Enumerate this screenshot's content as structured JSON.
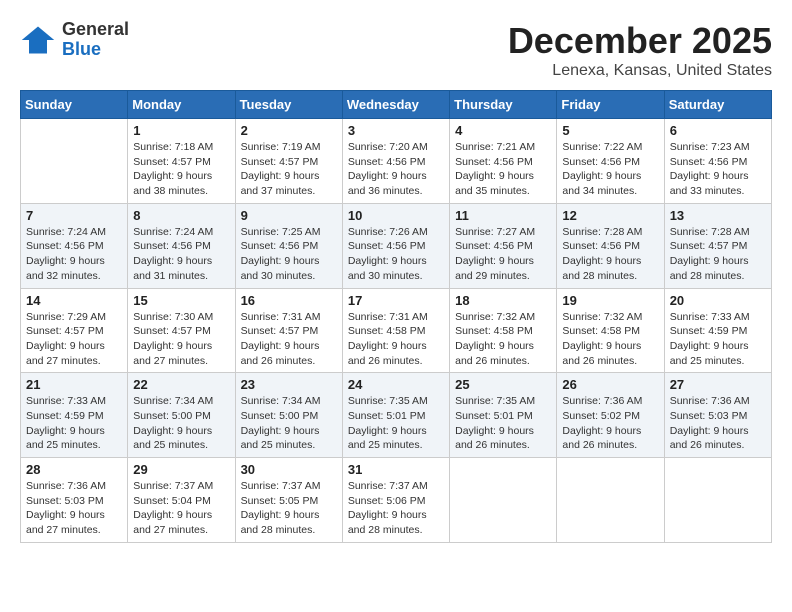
{
  "header": {
    "logo": {
      "general": "General",
      "blue": "Blue"
    },
    "title": "December 2025",
    "location": "Lenexa, Kansas, United States"
  },
  "weekdays": [
    "Sunday",
    "Monday",
    "Tuesday",
    "Wednesday",
    "Thursday",
    "Friday",
    "Saturday"
  ],
  "weeks": [
    [
      {
        "day": "",
        "info": ""
      },
      {
        "day": "1",
        "info": "Sunrise: 7:18 AM\nSunset: 4:57 PM\nDaylight: 9 hours\nand 38 minutes."
      },
      {
        "day": "2",
        "info": "Sunrise: 7:19 AM\nSunset: 4:57 PM\nDaylight: 9 hours\nand 37 minutes."
      },
      {
        "day": "3",
        "info": "Sunrise: 7:20 AM\nSunset: 4:56 PM\nDaylight: 9 hours\nand 36 minutes."
      },
      {
        "day": "4",
        "info": "Sunrise: 7:21 AM\nSunset: 4:56 PM\nDaylight: 9 hours\nand 35 minutes."
      },
      {
        "day": "5",
        "info": "Sunrise: 7:22 AM\nSunset: 4:56 PM\nDaylight: 9 hours\nand 34 minutes."
      },
      {
        "day": "6",
        "info": "Sunrise: 7:23 AM\nSunset: 4:56 PM\nDaylight: 9 hours\nand 33 minutes."
      }
    ],
    [
      {
        "day": "7",
        "info": "Sunrise: 7:24 AM\nSunset: 4:56 PM\nDaylight: 9 hours\nand 32 minutes."
      },
      {
        "day": "8",
        "info": "Sunrise: 7:24 AM\nSunset: 4:56 PM\nDaylight: 9 hours\nand 31 minutes."
      },
      {
        "day": "9",
        "info": "Sunrise: 7:25 AM\nSunset: 4:56 PM\nDaylight: 9 hours\nand 30 minutes."
      },
      {
        "day": "10",
        "info": "Sunrise: 7:26 AM\nSunset: 4:56 PM\nDaylight: 9 hours\nand 30 minutes."
      },
      {
        "day": "11",
        "info": "Sunrise: 7:27 AM\nSunset: 4:56 PM\nDaylight: 9 hours\nand 29 minutes."
      },
      {
        "day": "12",
        "info": "Sunrise: 7:28 AM\nSunset: 4:56 PM\nDaylight: 9 hours\nand 28 minutes."
      },
      {
        "day": "13",
        "info": "Sunrise: 7:28 AM\nSunset: 4:57 PM\nDaylight: 9 hours\nand 28 minutes."
      }
    ],
    [
      {
        "day": "14",
        "info": "Sunrise: 7:29 AM\nSunset: 4:57 PM\nDaylight: 9 hours\nand 27 minutes."
      },
      {
        "day": "15",
        "info": "Sunrise: 7:30 AM\nSunset: 4:57 PM\nDaylight: 9 hours\nand 27 minutes."
      },
      {
        "day": "16",
        "info": "Sunrise: 7:31 AM\nSunset: 4:57 PM\nDaylight: 9 hours\nand 26 minutes."
      },
      {
        "day": "17",
        "info": "Sunrise: 7:31 AM\nSunset: 4:58 PM\nDaylight: 9 hours\nand 26 minutes."
      },
      {
        "day": "18",
        "info": "Sunrise: 7:32 AM\nSunset: 4:58 PM\nDaylight: 9 hours\nand 26 minutes."
      },
      {
        "day": "19",
        "info": "Sunrise: 7:32 AM\nSunset: 4:58 PM\nDaylight: 9 hours\nand 26 minutes."
      },
      {
        "day": "20",
        "info": "Sunrise: 7:33 AM\nSunset: 4:59 PM\nDaylight: 9 hours\nand 25 minutes."
      }
    ],
    [
      {
        "day": "21",
        "info": "Sunrise: 7:33 AM\nSunset: 4:59 PM\nDaylight: 9 hours\nand 25 minutes."
      },
      {
        "day": "22",
        "info": "Sunrise: 7:34 AM\nSunset: 5:00 PM\nDaylight: 9 hours\nand 25 minutes."
      },
      {
        "day": "23",
        "info": "Sunrise: 7:34 AM\nSunset: 5:00 PM\nDaylight: 9 hours\nand 25 minutes."
      },
      {
        "day": "24",
        "info": "Sunrise: 7:35 AM\nSunset: 5:01 PM\nDaylight: 9 hours\nand 25 minutes."
      },
      {
        "day": "25",
        "info": "Sunrise: 7:35 AM\nSunset: 5:01 PM\nDaylight: 9 hours\nand 26 minutes."
      },
      {
        "day": "26",
        "info": "Sunrise: 7:36 AM\nSunset: 5:02 PM\nDaylight: 9 hours\nand 26 minutes."
      },
      {
        "day": "27",
        "info": "Sunrise: 7:36 AM\nSunset: 5:03 PM\nDaylight: 9 hours\nand 26 minutes."
      }
    ],
    [
      {
        "day": "28",
        "info": "Sunrise: 7:36 AM\nSunset: 5:03 PM\nDaylight: 9 hours\nand 27 minutes."
      },
      {
        "day": "29",
        "info": "Sunrise: 7:37 AM\nSunset: 5:04 PM\nDaylight: 9 hours\nand 27 minutes."
      },
      {
        "day": "30",
        "info": "Sunrise: 7:37 AM\nSunset: 5:05 PM\nDaylight: 9 hours\nand 28 minutes."
      },
      {
        "day": "31",
        "info": "Sunrise: 7:37 AM\nSunset: 5:06 PM\nDaylight: 9 hours\nand 28 minutes."
      },
      {
        "day": "",
        "info": ""
      },
      {
        "day": "",
        "info": ""
      },
      {
        "day": "",
        "info": ""
      }
    ]
  ]
}
